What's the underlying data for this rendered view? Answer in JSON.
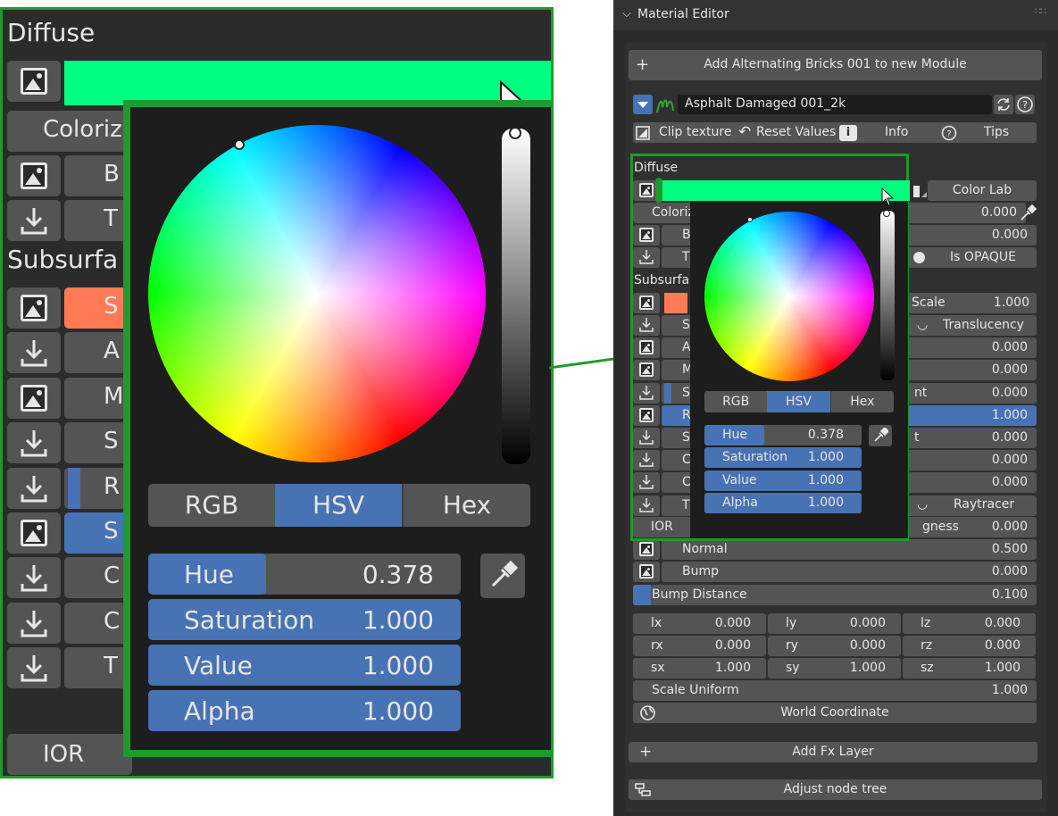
{
  "panel": {
    "title": "Material Editor",
    "add_module_label": "Add Alternating Bricks 001 to new Module",
    "material_name": "Asphalt Damaged 001_2k",
    "toolbar": {
      "clip_texture": "Clip texture",
      "reset_values": "Reset Values",
      "info": "Info",
      "tips": "Tips"
    },
    "diffuse_label": "Diffuse",
    "color_lab": "Color Lab",
    "colorize_label": "Coloriz",
    "colorize_value": "0.000",
    "row_b_label": "B",
    "row_b_value": "0.000",
    "row_t_label": "T",
    "is_opaque": "Is OPAQUE",
    "subsurface_label": "Subsurfa",
    "scale_label": "Scale",
    "scale_value": "1.000",
    "translucency": "Translucency",
    "sub_rows": [
      {
        "letter": "S",
        "side": "",
        "value": ""
      },
      {
        "letter": "A",
        "side": "",
        "value": "0.000"
      },
      {
        "letter": "M",
        "side": "",
        "value": "0.000"
      },
      {
        "letter": "S",
        "side": "nt",
        "value": "0.000"
      },
      {
        "letter": "R",
        "side": "",
        "value": "1.000"
      },
      {
        "letter": "S",
        "side": "t",
        "value": "0.000"
      },
      {
        "letter": "C",
        "side": "",
        "value": "0.000"
      },
      {
        "letter": "C",
        "side": "",
        "value": "0.000"
      },
      {
        "letter": "T",
        "side": "",
        "value": ""
      }
    ],
    "raytracer": "Raytracer",
    "ior": "IOR",
    "roughness_tail": "gness",
    "roughness_value": "0.000",
    "normal_label": "Normal",
    "normal_value": "0.500",
    "bump_label": "Bump",
    "bump_value": "0.000",
    "bump_distance_label": "Bump Distance",
    "bump_distance_value": "0.100",
    "transform": [
      [
        {
          "k": "lx",
          "v": "0.000"
        },
        {
          "k": "ly",
          "v": "0.000"
        },
        {
          "k": "lz",
          "v": "0.000"
        }
      ],
      [
        {
          "k": "rx",
          "v": "0.000"
        },
        {
          "k": "ry",
          "v": "0.000"
        },
        {
          "k": "rz",
          "v": "0.000"
        }
      ],
      [
        {
          "k": "sx",
          "v": "1.000"
        },
        {
          "k": "sy",
          "v": "1.000"
        },
        {
          "k": "sz",
          "v": "1.000"
        }
      ]
    ],
    "scale_uniform_label": "Scale Uniform",
    "scale_uniform_value": "1.000",
    "world_coordinate": "World Coordinate",
    "add_fx_layer": "Add Fx Layer",
    "adjust_node_tree": "Adjust node tree"
  },
  "color_picker": {
    "tabs": [
      "RGB",
      "HSV",
      "Hex"
    ],
    "active_tab": "HSV",
    "fields": [
      {
        "label": "Hue",
        "value": "0.378",
        "fill": 0.378
      },
      {
        "label": "Saturation",
        "value": "1.000",
        "fill": 1.0
      },
      {
        "label": "Value",
        "value": "1.000",
        "fill": 1.0
      },
      {
        "label": "Alpha",
        "value": "1.000",
        "fill": 1.0
      }
    ],
    "color": "#00ff80"
  },
  "zoom": {
    "diffuse_label": "Diffuse",
    "colorize_label": "Coloriz",
    "b_label": "B",
    "t_label": "T",
    "subsurface_label": "Subsurfa",
    "letters": [
      "S",
      "A",
      "M",
      "S",
      "R",
      "S",
      "C",
      "C",
      "T"
    ],
    "ior": "IOR"
  },
  "colors": {
    "accent_green": "#00ff80",
    "highlight_border": "#1e9a2e",
    "field_blue": "#4772b3",
    "subsurface_color": "#ff7a55"
  }
}
